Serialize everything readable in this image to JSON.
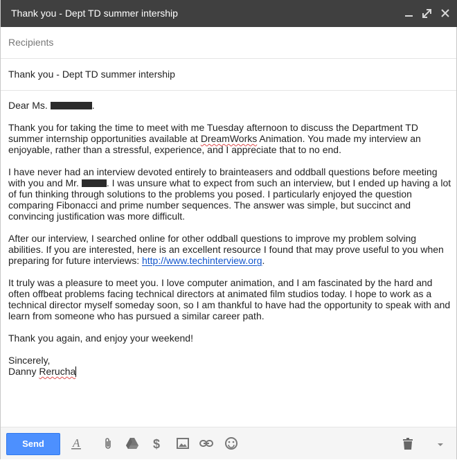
{
  "window": {
    "title": "Thank you - Dept TD summer intership"
  },
  "recipients": {
    "placeholder": "Recipients"
  },
  "subject": {
    "value": "Thank you - Dept TD summer intership"
  },
  "body": {
    "salutation": "Dear Ms.",
    "salutation_end": ".",
    "p1": "Thank you for taking the time to meet with me Tuesday afternoon to discuss the Department TD summer internship opportunities available at DreamWorks Animation. You made my interview an enjoyable, rather than a stressful, experience, and I appreciate that to no end.",
    "p1_a": "Thank you for taking the time to meet with me Tuesday afternoon to discuss the Department TD summer internship opportunities available at ",
    "p1_b": "DreamWorks",
    "p1_c": " Animation. You made my interview an enjoyable, rather than a stressful, experience, and I appreciate that to no end.",
    "p2_a": "I have never had an interview devoted entirely to brainteasers and oddball questions before meeting with you and Mr. ",
    "p2_b": ". I was unsure what to expect from such an interview, but I ended up having a lot of fun thinking through solutions to the problems you posed. I particularly enjoyed the question comparing Fibonacci and prime number sequences. The answer was simple, but succinct and convincing justification was more difficult.",
    "p3_a": "After our interview, I searched online for other oddball questions to improve my problem solving abilities. If you are interested, here is an excellent resource I found that may prove useful to you when preparing for future interviews: ",
    "p3_link": "http://www.techinterview.org",
    "p3_c": ".",
    "p4": "It truly was a pleasure to meet you. I love computer animation, and I am fascinated by the hard and often offbeat problems facing technical directors at animated film studios today. I hope to work as a technical director myself someday soon, so I am thankful to have had the opportunity to speak with and learn from someone who has pursued a similar career path.",
    "p5": "Thank you again, and enjoy your weekend!",
    "closing": "Sincerely,",
    "signature_first": "Danny ",
    "signature_last": "Rerucha"
  },
  "toolbar": {
    "send_label": "Send",
    "icons": [
      "formatting-icon",
      "attach-icon",
      "drive-icon",
      "money-icon",
      "photo-icon",
      "link-icon",
      "emoji-icon",
      "trash-icon",
      "more-options-icon"
    ]
  },
  "colors": {
    "titlebar": "#404040",
    "send_button": "#4d90fe",
    "link": "#1155cc"
  }
}
